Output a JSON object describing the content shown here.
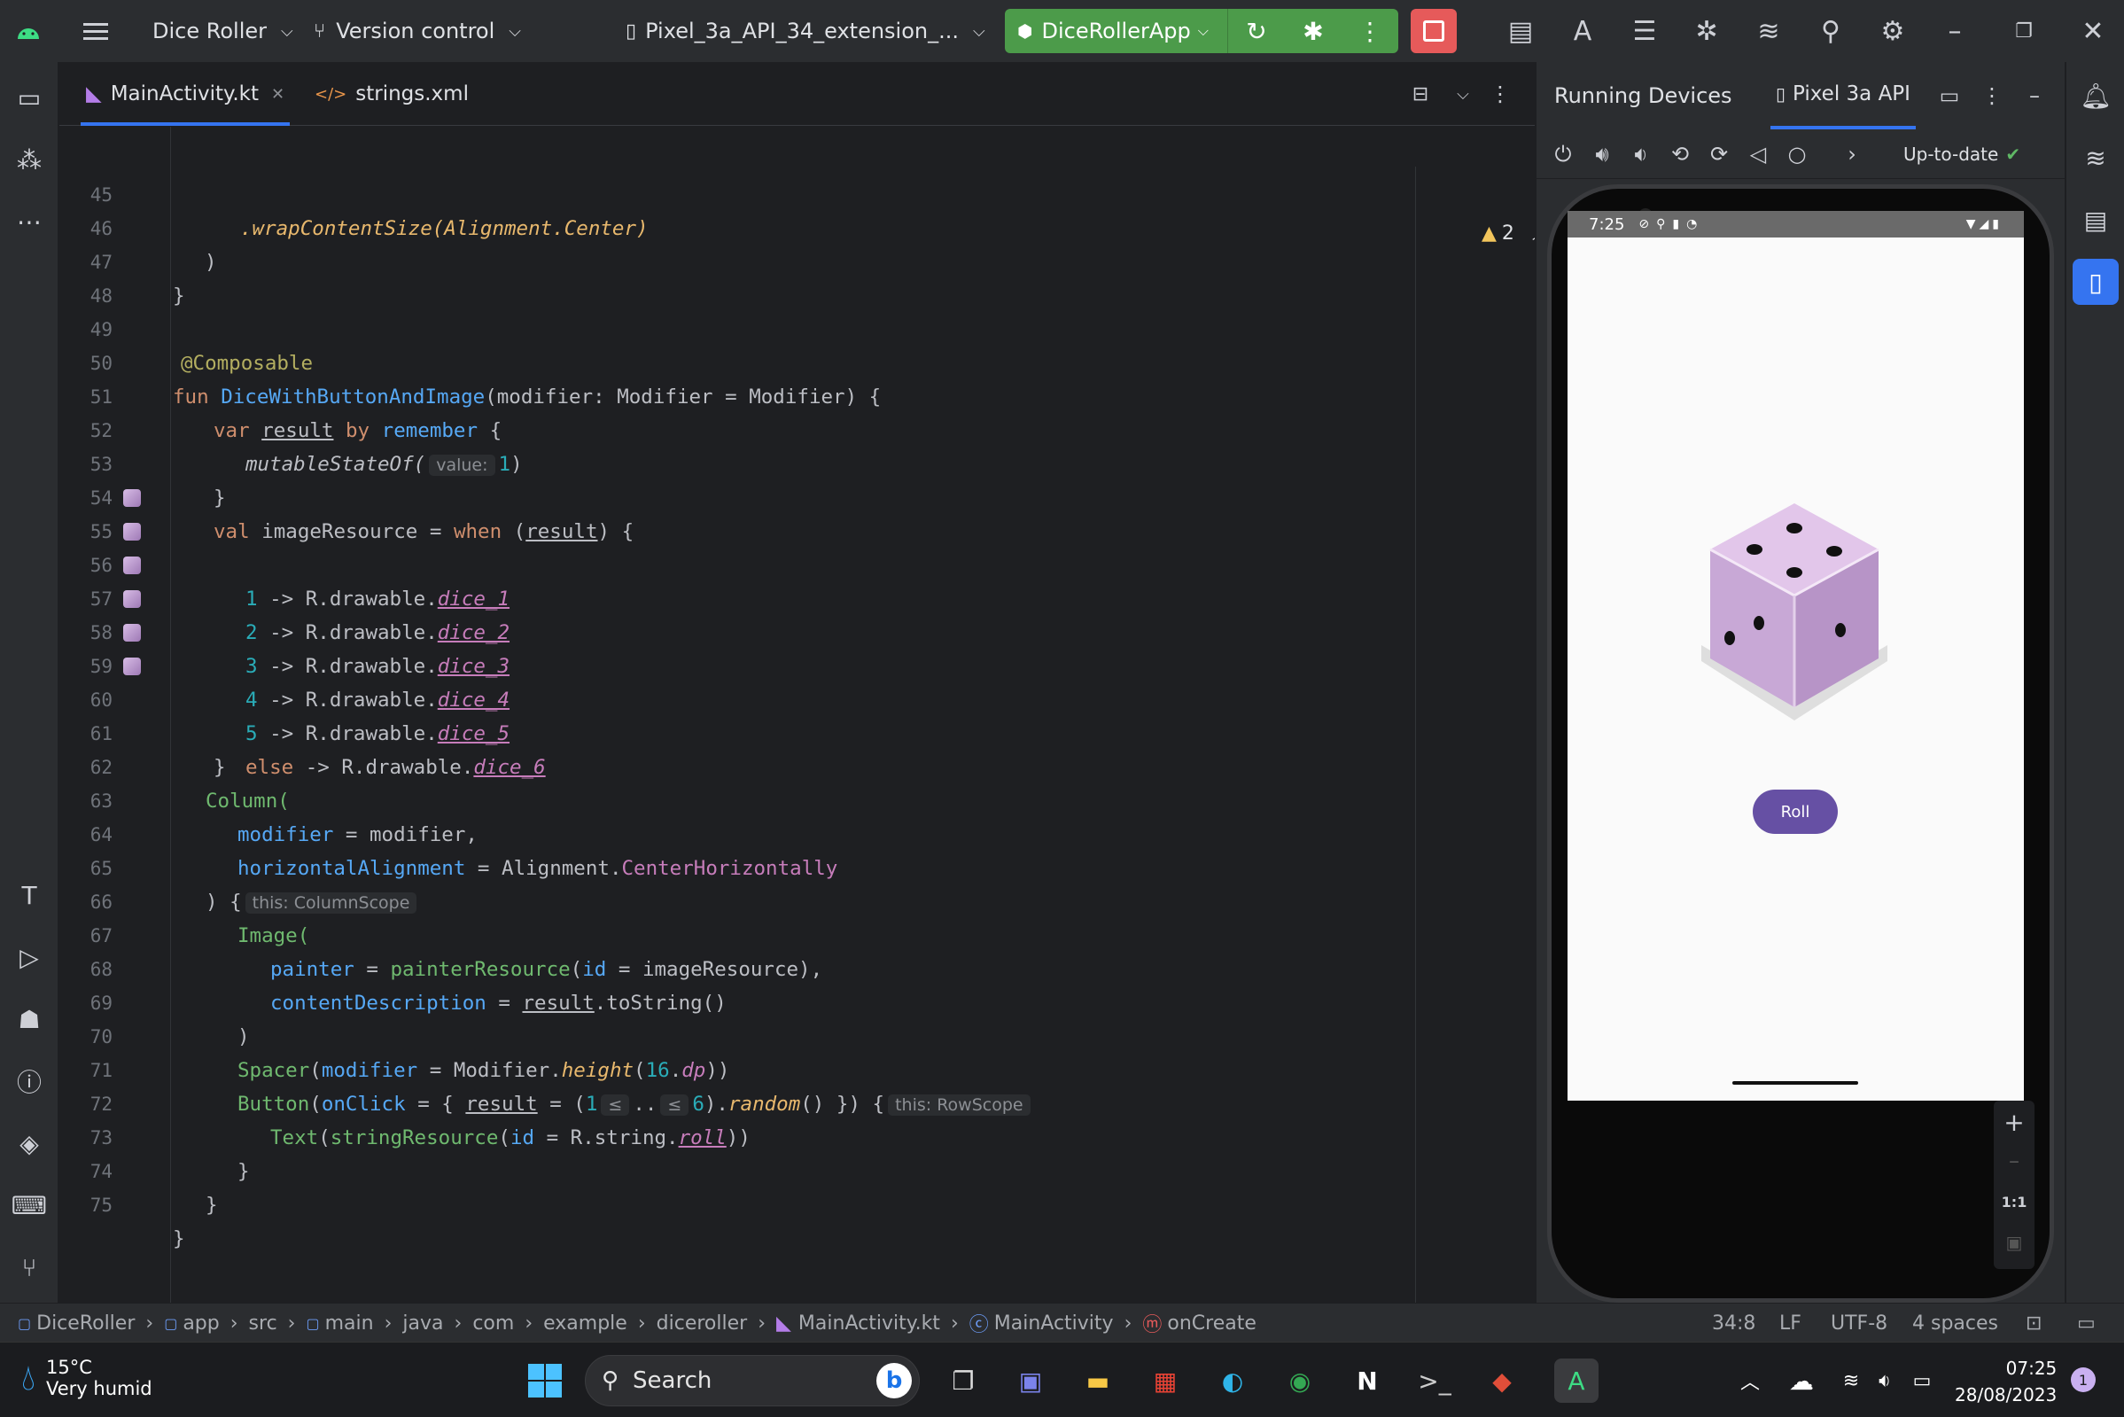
{
  "titlebar": {
    "project": "Dice Roller",
    "vcs": "Version control",
    "device": "Pixel_3a_API_34_extension_...",
    "run_config": "DiceRollerApp"
  },
  "tabs": [
    {
      "label": "MainActivity.kt",
      "active": true
    },
    {
      "label": "strings.xml",
      "active": false
    }
  ],
  "editor": {
    "warning_count": "2",
    "lines": [
      {
        "n": "45"
      },
      {
        "n": "46"
      },
      {
        "n": "47"
      },
      {
        "n": "48"
      },
      {
        "n": "49"
      },
      {
        "n": "50"
      },
      {
        "n": "51"
      },
      {
        "n": "52"
      },
      {
        "n": "53"
      },
      {
        "n": "54"
      },
      {
        "n": "55"
      },
      {
        "n": "56"
      },
      {
        "n": "57"
      },
      {
        "n": "58"
      },
      {
        "n": "59"
      },
      {
        "n": "60"
      },
      {
        "n": "61"
      },
      {
        "n": "62"
      },
      {
        "n": "63"
      },
      {
        "n": "64"
      },
      {
        "n": "65"
      },
      {
        "n": "66"
      },
      {
        "n": "67"
      },
      {
        "n": "68"
      },
      {
        "n": "69"
      },
      {
        "n": "70"
      },
      {
        "n": "71"
      },
      {
        "n": "72"
      },
      {
        "n": "73"
      },
      {
        "n": "74"
      },
      {
        "n": "75"
      }
    ],
    "code": {
      "l45": ".wrapContentSize(Alignment.Center)",
      "l46": ")",
      "l47": "}",
      "l49": "@Composable",
      "l50_kw": "fun ",
      "l50_fn": "DiceWithButtonAndImage",
      "l50_rest": "(modifier: Modifier = Modifier) {",
      "l51_kw": "var ",
      "l51_var": "result",
      "l51_by": " by ",
      "l51_rem": "remember",
      "l51_rest": " {",
      "l52_fn": "mutableStateOf(",
      "l52_hint": "value:",
      "l52_num": "1",
      "l52_rest": ")",
      "l53": "}",
      "l54_kw": "val ",
      "l54_a": "imageResource = ",
      "l54_when": "when ",
      "l54_b": "(",
      "l54_res": "result",
      "l54_c": ") {",
      "dice": [
        {
          "num": "1",
          "res": "dice_1"
        },
        {
          "num": "2",
          "res": "dice_2"
        },
        {
          "num": "3",
          "res": "dice_3"
        },
        {
          "num": "4",
          "res": "dice_4"
        },
        {
          "num": "5",
          "res": "dice_5"
        }
      ],
      "arrow": " -> R.drawable.",
      "l60_else": "else",
      "l60_res": "dice_6",
      "l61": "}",
      "l62": "Column(",
      "l63_p": "modifier",
      "l63_rest": " = modifier,",
      "l64_p": "horizontalAlignment",
      "l64_a": " = Alignment.",
      "l64_b": "CenterHorizontally",
      "l65": ") {",
      "l65_hint": "this: ColumnScope",
      "l66": "Image(",
      "l67_p": "painter",
      "l67_a": " = ",
      "l67_fn": "painterResource",
      "l67_b": "(",
      "l67_p2": "id",
      "l67_c": " = imageResource),",
      "l68_p": "contentDescription",
      "l68_a": " = ",
      "l68_res": "result",
      "l68_b": ".toString()",
      "l69": ")",
      "l70_fn": "Spacer",
      "l70_a": "(",
      "l70_p": "modifier",
      "l70_b": " = Modifier.",
      "l70_ital": "height",
      "l70_c": "(",
      "l70_num": "16",
      "l70_d": ".",
      "l70_dp": "dp",
      "l70_e": "))",
      "l71_fn": "Button",
      "l71_a": "(",
      "l71_p": "onClick",
      "l71_b": " = { ",
      "l71_res": "result",
      "l71_c": " = (",
      "l71_n1": "1",
      "l71_h1": "≤",
      "l71_dots": "..",
      "l71_h2": "≤",
      "l71_n2": "6",
      "l71_d": ").",
      "l71_ital": "random",
      "l71_e": "() }) {",
      "l71_hint": "this: RowScope",
      "l72_fn": "Text",
      "l72_a": "(",
      "l72_fn2": "stringResource",
      "l72_b": "(",
      "l72_p": "id",
      "l72_c": " = R.string.",
      "l72_res": "roll",
      "l72_d": "))",
      "l73": "}",
      "l74": "}",
      "l75": "}"
    }
  },
  "devices": {
    "title": "Running Devices",
    "tab": "Pixel 3a API",
    "status": "Up-to-date",
    "phone_time": "7:25",
    "roll_label": "Roll",
    "zoom_label": "1:1"
  },
  "statusbar": {
    "crumbs": [
      "DiceRoller",
      "app",
      "src",
      "main",
      "java",
      "com",
      "example",
      "diceroller",
      "MainActivity.kt",
      "MainActivity",
      "onCreate"
    ],
    "position": "34:8",
    "line_sep": "LF",
    "encoding": "UTF-8",
    "indent": "4 spaces"
  },
  "taskbar": {
    "temp": "15°C",
    "weather": "Very humid",
    "search": "Search",
    "time": "07:25",
    "date": "28/08/2023",
    "notifications": "1"
  }
}
